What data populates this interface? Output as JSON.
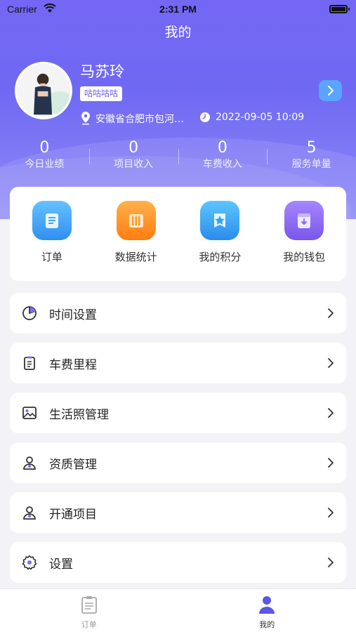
{
  "status_bar": {
    "carrier": "Carrier",
    "time": "2:31 PM"
  },
  "header": {
    "title": "我的"
  },
  "profile": {
    "name": "马苏玲",
    "tag": "咕咕咕咕",
    "location": "安徽省合肥市包河…",
    "datetime": "2022-09-05 10:09"
  },
  "stats": [
    {
      "value": "0",
      "label": "今日业绩"
    },
    {
      "value": "0",
      "label": "项目收入"
    },
    {
      "value": "0",
      "label": "车费收入"
    },
    {
      "value": "5",
      "label": "服务单量"
    }
  ],
  "quick_actions": [
    {
      "label": "订单",
      "icon": "order-scroll-icon",
      "color": "#3aa7f3"
    },
    {
      "label": "数据统计",
      "icon": "data-stats-icon",
      "color": "#ff9a1d"
    },
    {
      "label": "我的积分",
      "icon": "star-points-icon",
      "color": "#2aa5ee"
    },
    {
      "label": "我的钱包",
      "icon": "wallet-icon",
      "color": "#8a66ef"
    }
  ],
  "menu": [
    {
      "label": "时间设置",
      "icon": "pie-chart-icon"
    },
    {
      "label": "车费里程",
      "icon": "clipboard-icon"
    },
    {
      "label": "生活照管理",
      "icon": "photo-icon"
    },
    {
      "label": "资质管理",
      "icon": "person-icon"
    },
    {
      "label": "开通项目",
      "icon": "person-icon"
    },
    {
      "label": "设置",
      "icon": "gear-icon"
    }
  ],
  "tabbar": [
    {
      "label": "订单",
      "icon": "clipboard-tab-icon",
      "active": false
    },
    {
      "label": "我的",
      "icon": "user-tab-icon",
      "active": true
    }
  ],
  "colors": {
    "accent": "#6a5df2",
    "active_tab": "#5b57e8",
    "inactive_tab": "#999999"
  }
}
